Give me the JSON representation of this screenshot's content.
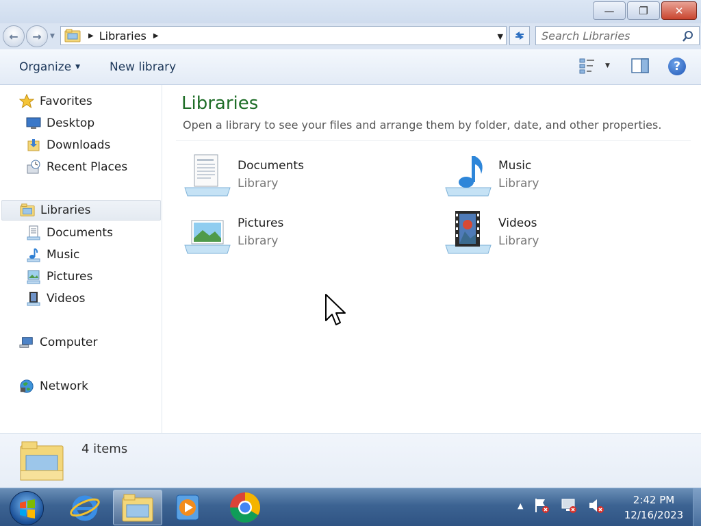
{
  "window": {
    "controls": {
      "minimize": "—",
      "maximize": "❐",
      "close": "✕"
    }
  },
  "address": {
    "breadcrumb": [
      "Libraries"
    ],
    "search_placeholder": "Search Libraries"
  },
  "toolbar": {
    "organize": "Organize",
    "new_library": "New library"
  },
  "nav": {
    "favorites": {
      "label": "Favorites",
      "items": [
        "Desktop",
        "Downloads",
        "Recent Places"
      ]
    },
    "libraries": {
      "label": "Libraries",
      "items": [
        "Documents",
        "Music",
        "Pictures",
        "Videos"
      ]
    },
    "computer": "Computer",
    "network": "Network"
  },
  "content": {
    "title": "Libraries",
    "description": "Open a library to see your files and arrange them by folder, date, and other properties.",
    "libraries": [
      {
        "name": "Documents",
        "type": "Library",
        "icon": "documents-library-icon"
      },
      {
        "name": "Music",
        "type": "Library",
        "icon": "music-library-icon"
      },
      {
        "name": "Pictures",
        "type": "Library",
        "icon": "pictures-library-icon"
      },
      {
        "name": "Videos",
        "type": "Library",
        "icon": "videos-library-icon"
      }
    ]
  },
  "details": {
    "count": "4 items"
  },
  "taskbar": {
    "items": [
      "start-orb",
      "internet-explorer",
      "windows-explorer",
      "windows-media-player",
      "google-chrome"
    ],
    "time": "2:42 PM",
    "date": "12/16/2023"
  },
  "colors": {
    "title_green": "#1e6d27",
    "taskbar": "#3c6392"
  }
}
